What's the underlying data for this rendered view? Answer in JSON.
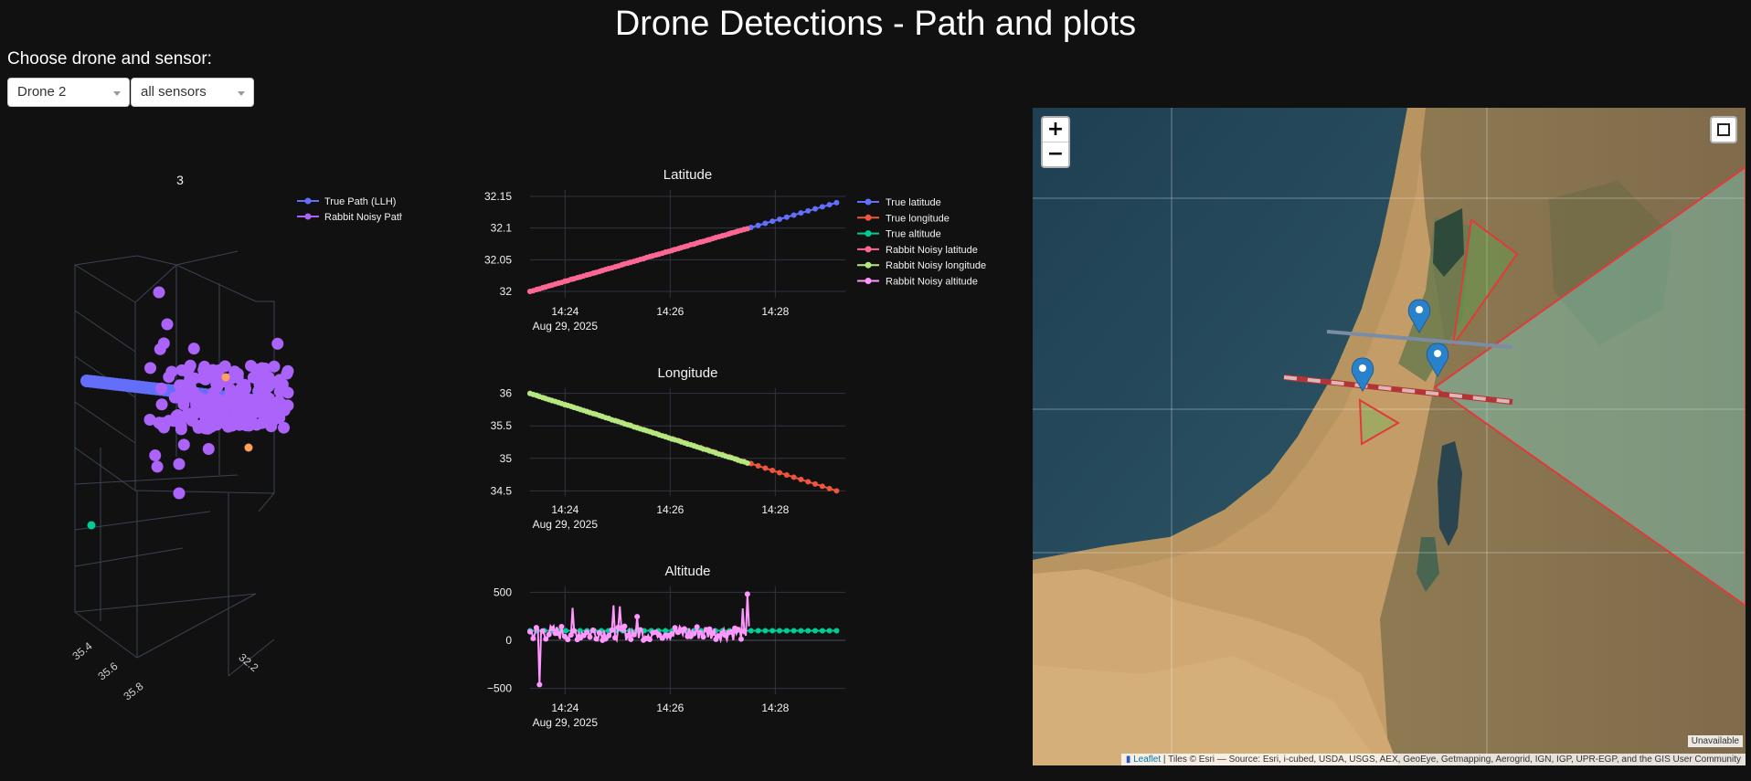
{
  "page": {
    "title": "Drone Detections - Path and plots"
  },
  "controls": {
    "label": "Choose drone and sensor:",
    "drone_value": "Drone 2",
    "sensor_value": "all sensors"
  },
  "plot3d": {
    "title": "3",
    "legend": [
      "True Path (LLH)",
      "Rabbit Noisy Path"
    ],
    "tick_labels_lon": [
      "35.4",
      "35.6",
      "35.8"
    ],
    "tick_labels_lat": [
      "32.2"
    ]
  },
  "colors": {
    "true_latitude": "#636efa",
    "true_longitude": "#ef553b",
    "true_altitude": "#00cc96",
    "rabbit_latitude": "#ff6692",
    "rabbit_longitude": "#b6e880",
    "rabbit_altitude": "#ff97ff",
    "noisy_path_3d": "#ab63fa",
    "true_path_3d": "#636efa"
  },
  "legend2d": [
    "True latitude",
    "True longitude",
    "True altitude",
    "Rabbit Noisy latitude",
    "Rabbit Noisy longitude",
    "Rabbit Noisy altitude"
  ],
  "chart_data": [
    {
      "type": "line",
      "title": "Latitude",
      "x_ticks": [
        "14:24",
        "14:26",
        "14:28"
      ],
      "x_date_label": "Aug 29, 2025",
      "y_ticks": [
        "32",
        "32.05",
        "32.1",
        "32.15"
      ],
      "ylim": [
        31.99,
        32.16
      ],
      "x_range_minutes": [
        "14:23:20",
        "14:29:20"
      ],
      "series": [
        {
          "name": "True latitude",
          "x_start": "14:23:20",
          "x_end": "14:29:10",
          "y_start": 32.0,
          "y_end": 32.14
        },
        {
          "name": "Rabbit Noisy latitude",
          "x_start": "14:23:20",
          "x_end": "14:27:30",
          "y_start": 32.0,
          "y_end": 32.1
        }
      ]
    },
    {
      "type": "line",
      "title": "Longitude",
      "x_ticks": [
        "14:24",
        "14:26",
        "14:28"
      ],
      "x_date_label": "Aug 29, 2025",
      "y_ticks": [
        "34.5",
        "35",
        "35.5",
        "36"
      ],
      "ylim": [
        34.42,
        36.08
      ],
      "series": [
        {
          "name": "True longitude",
          "x_start": "14:23:20",
          "x_end": "14:29:10",
          "y_start": 36.0,
          "y_end": 34.5
        },
        {
          "name": "Rabbit Noisy longitude",
          "x_start": "14:23:20",
          "x_end": "14:27:30",
          "y_start": 36.0,
          "y_end": 34.92
        }
      ]
    },
    {
      "type": "line",
      "title": "Altitude",
      "x_ticks": [
        "14:24",
        "14:26",
        "14:28"
      ],
      "x_date_label": "Aug 29, 2025",
      "y_ticks": [
        "−500",
        "0",
        "500"
      ],
      "ylim": [
        -560,
        560
      ],
      "series": [
        {
          "name": "True altitude",
          "x_start": "14:23:20",
          "x_end": "14:29:10",
          "y_const": 100
        },
        {
          "name": "Rabbit Noisy altitude",
          "x_start": "14:23:20",
          "x_end": "14:27:30",
          "y_mean": 80,
          "y_min": -460,
          "y_max": 480
        }
      ]
    }
  ],
  "map": {
    "zoom_in": "+",
    "zoom_out": "−",
    "unavailable": "Unavailable",
    "attribution_link": "Leaflet",
    "attribution_text": " | Tiles © Esri — Source: Esri, i-cubed, USDA, USGS, AEX, GeoEye, Getmapping, Aerogrid, IGN, IGP, UPR-EGP, and the GIS User Community"
  }
}
